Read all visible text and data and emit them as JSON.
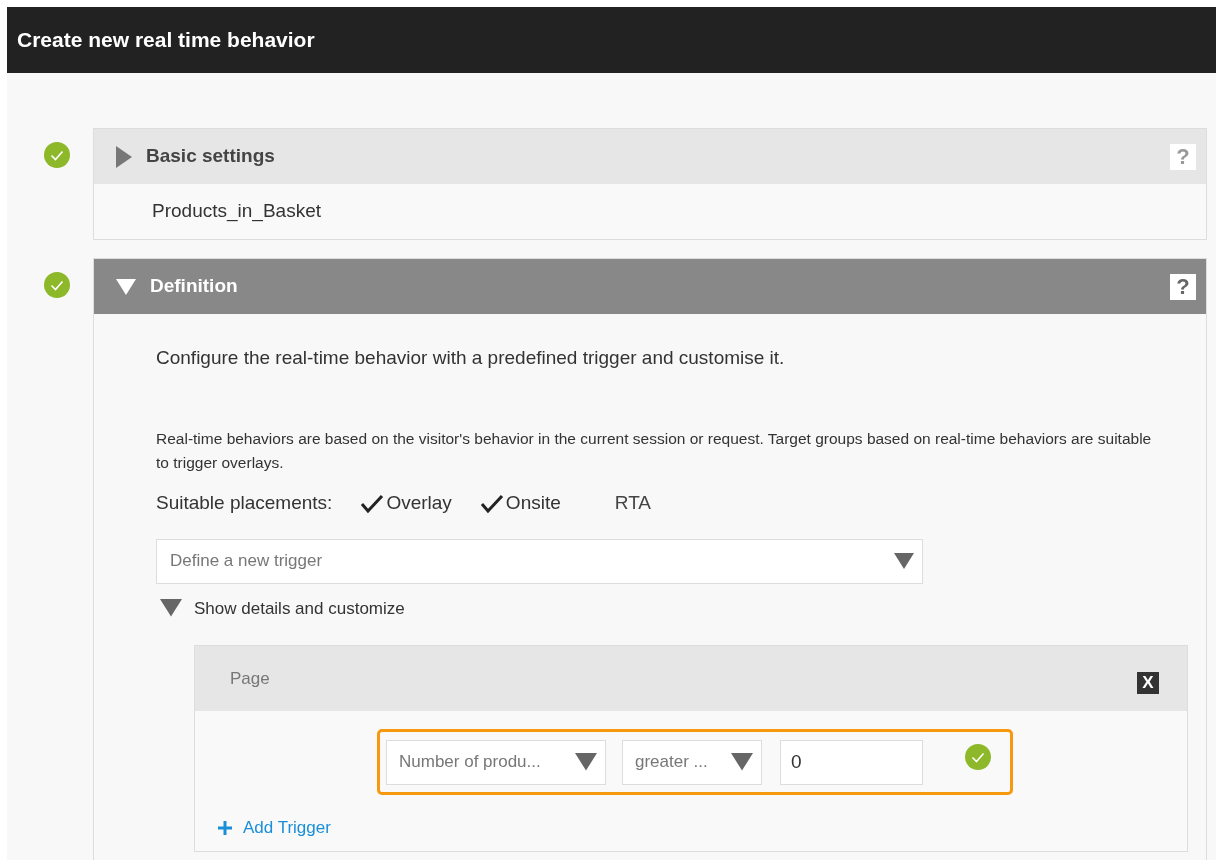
{
  "window": {
    "title": "Create new real time behavior"
  },
  "sections": [
    {
      "title": "Basic settings",
      "expanded": false,
      "complete": true,
      "help": "?",
      "summary": "Products_in_Basket"
    },
    {
      "title": "Definition",
      "expanded": true,
      "complete": true,
      "help": "?"
    }
  ],
  "definition": {
    "intro": "Configure the real-time behavior with a predefined trigger and customise it.",
    "note": "Real-time behaviors are based on the visitor's behavior in the current session or request. Target groups based on real-time behaviors are suitable to trigger overlays.",
    "placements_label": "Suitable placements:",
    "placements": [
      {
        "label": "Overlay",
        "checked": true
      },
      {
        "label": "Onsite",
        "checked": true
      },
      {
        "label": "RTA",
        "checked": false
      }
    ],
    "trigger_select": {
      "placeholder": "Define a new trigger"
    },
    "details_toggle": {
      "label": "Show details and customize",
      "expanded": true
    },
    "trigger_group": {
      "title": "Page",
      "close": "X",
      "condition": {
        "field": "Number of produ...",
        "operator": "greater ...",
        "value": "0",
        "valid": true
      },
      "add_label": "Add Trigger"
    }
  }
}
